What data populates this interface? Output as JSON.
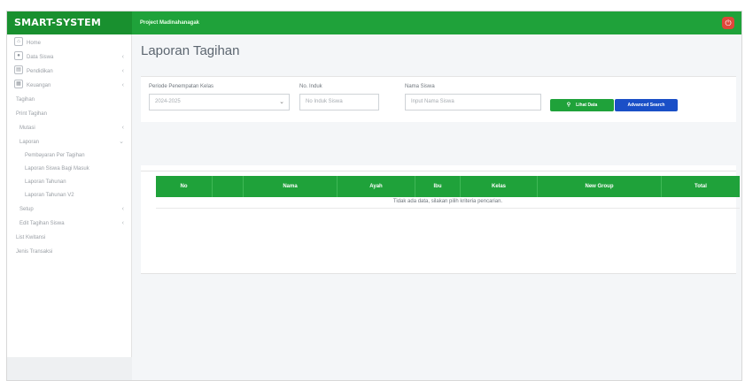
{
  "app": {
    "brand": "SMART-SYSTEM",
    "project": "Project Madinahanagak"
  },
  "sidebar": {
    "items": [
      {
        "label": "Home",
        "icon": "home-icon",
        "level": 0,
        "chevron": false
      },
      {
        "label": "Data Siswa",
        "icon": "user-icon",
        "level": 0,
        "chevron": true
      },
      {
        "label": "Pendidikan",
        "icon": "book-icon",
        "level": 0,
        "chevron": true
      },
      {
        "label": "Keuangan",
        "icon": "grid-icon",
        "level": 0,
        "chevron": true
      },
      {
        "label": "Tagihan",
        "level": 1,
        "chevron": false
      },
      {
        "label": "Print Tagihan",
        "level": 1,
        "chevron": false
      },
      {
        "label": "Mutasi",
        "level": 2,
        "chevron": true
      },
      {
        "label": "Laporan",
        "level": 2,
        "chevron": true
      },
      {
        "label": "Pembayaran Per Tagihan",
        "level": 3,
        "chevron": false
      },
      {
        "label": "Laporan Siswa Bagi Masuk",
        "level": 3,
        "chevron": false
      },
      {
        "label": "Laporan Tahunan",
        "level": 3,
        "chevron": false
      },
      {
        "label": "Laporan Tahunan V2",
        "level": 3,
        "chevron": false
      },
      {
        "label": "Setup",
        "level": 2,
        "chevron": true
      },
      {
        "label": "Edit Tagihan Siswa",
        "level": 2,
        "chevron": true
      },
      {
        "label": "List Kwitansi",
        "level": 1,
        "chevron": false
      },
      {
        "label": "Jenis Transaksi",
        "level": 1,
        "chevron": false
      }
    ]
  },
  "page": {
    "title": "Laporan Tagihan"
  },
  "filters": {
    "period_label": "Periode Penempatan Kelas",
    "period_value": "2024-2025",
    "nis_label": "No. Induk",
    "nis_placeholder": "No Induk Siswa",
    "name_label": "Nama Siswa",
    "name_placeholder": "Input Nama Siswa",
    "view_button": "Lihat Data",
    "advanced_button": "Advanced Search"
  },
  "table": {
    "columns": [
      "No",
      "",
      "Nama",
      "Ayah",
      "Ibu",
      "Kelas",
      "New Group",
      "Total"
    ],
    "empty_message": "Tidak ada data, silakan pilih kriteria pencarian."
  },
  "colors": {
    "primary": "#1fa23a",
    "accent": "#1a4fc7",
    "danger": "#e0463a"
  }
}
